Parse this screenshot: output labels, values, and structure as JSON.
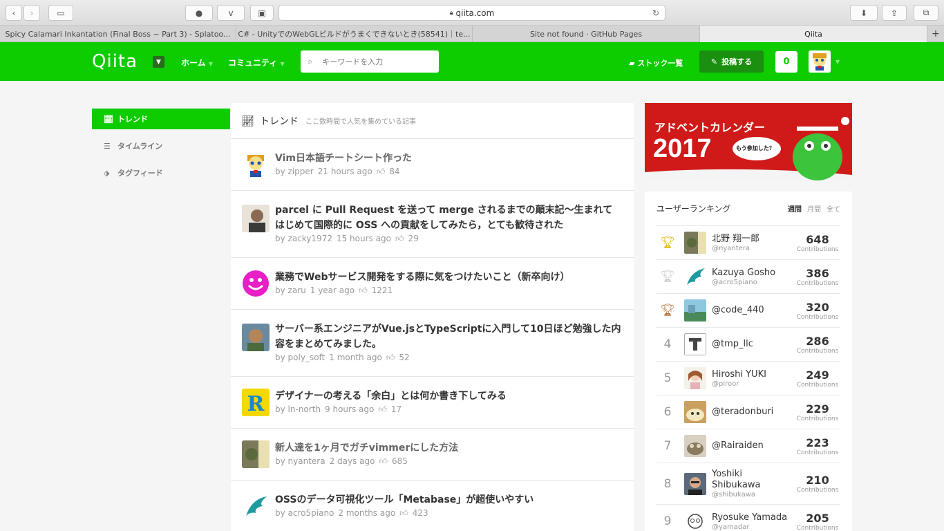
{
  "browser": {
    "url": "qiita.com",
    "tabs": [
      "Spicy Calamari Inkantation (Final Boss ~ Part 3) - Splatoo...",
      "C# - UnityでのWebGLビルドがうまくできないとき(58541)｜te...",
      "Site not found · GitHub Pages",
      "Qiita"
    ]
  },
  "header": {
    "logo": "Qiita",
    "nav": [
      "ホーム",
      "コミュニティ"
    ],
    "search_placeholder": "キーワードを入力",
    "stock_label": "ストック一覧",
    "post_label": "投稿する",
    "notifications": "0"
  },
  "sidebar": {
    "items": [
      "トレンド",
      "タイムライン",
      "タグフィード"
    ]
  },
  "main": {
    "title": "トレンド",
    "subtitle": "ここ数時間で人気を集めている記事",
    "articles": [
      {
        "title": "Vim日本語チートシート作った",
        "user": "zipper",
        "time": "21 hours ago",
        "likes": "84"
      },
      {
        "title": "parcel に Pull Request を送って merge されるまでの顛末記〜生まれて はじめて国際的に OSS への貢献をしてみたら，とても歓待された",
        "user": "zacky1972",
        "time": "15 hours ago",
        "likes": "29"
      },
      {
        "title": "業務でWebサービス開発をする際に気をつけたいこと（新卒向け）",
        "user": "zaru",
        "time": "1 year ago",
        "likes": "1221"
      },
      {
        "title": "サーバー系エンジニアがVue.jsとTypeScriptに入門して10日ほど勉強した内容をまとめてみました。",
        "user": "poly_soft",
        "time": "1 month ago",
        "likes": "52"
      },
      {
        "title": "デザイナーの考える「余白」とは何か書き下してみる",
        "user": "ln-north",
        "time": "9 hours ago",
        "likes": "17"
      },
      {
        "title": "新人達を1ヶ月でガチvimmerにした方法",
        "user": "nyantera",
        "time": "2 days ago",
        "likes": "685"
      },
      {
        "title": "OSSのデータ可視化ツール「Metabase」が超使いやすい",
        "user": "acro5piano",
        "time": "2 months ago",
        "likes": "423"
      }
    ]
  },
  "banner": {
    "line1": "アドベントカレンダー",
    "year": "2017",
    "bubble": "もう参加した？"
  },
  "ranking": {
    "title": "ユーザーランキング",
    "periods": [
      "週間",
      "月間",
      "全て"
    ],
    "contrib_label": "Contributions",
    "users": [
      {
        "rank": "",
        "name": "北野 翔一郎",
        "handle": "@nyantera",
        "score": "648"
      },
      {
        "rank": "",
        "name": "Kazuya Gosho",
        "handle": "@acro5piano",
        "score": "386"
      },
      {
        "rank": "",
        "name": "@code_440",
        "handle": "",
        "score": "320"
      },
      {
        "rank": "4",
        "name": "@tmp_llc",
        "handle": "",
        "score": "286"
      },
      {
        "rank": "5",
        "name": "Hiroshi YUKI",
        "handle": "@piroor",
        "score": "249"
      },
      {
        "rank": "6",
        "name": "@teradonburi",
        "handle": "",
        "score": "229"
      },
      {
        "rank": "7",
        "name": "@Rairaiden",
        "handle": "",
        "score": "223"
      },
      {
        "rank": "8",
        "name": "Yoshiki Shibukawa",
        "handle": "@shibukawa",
        "score": "210"
      },
      {
        "rank": "9",
        "name": "Ryosuke Yamada",
        "handle": "@yamadar",
        "score": "205"
      }
    ]
  },
  "colors": {
    "brand": "#0dcc00",
    "brand_dark": "#1b8f10"
  }
}
